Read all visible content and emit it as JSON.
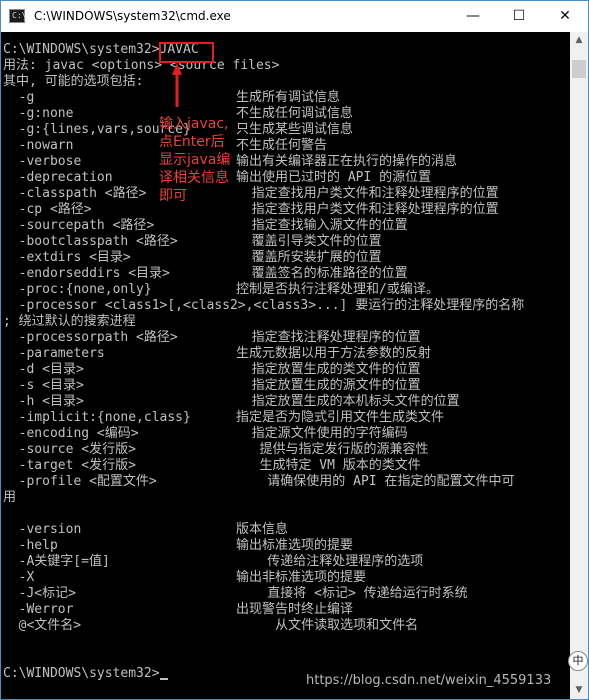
{
  "window": {
    "title": "C:\\WINDOWS\\system32\\cmd.exe",
    "icon_glyph": "C:\\",
    "minimize_glyph": "—",
    "maximize_glyph": "☐",
    "close_glyph": "✕"
  },
  "console": {
    "lines": [
      {
        "a": "C:\\WINDOWS\\system32>JAVAC"
      },
      {
        "a": "用法: javac <options> <source files>"
      },
      {
        "a": "其中, 可能的选项包括:"
      },
      {
        "a": "  -g",
        "b": "生成所有调试信息"
      },
      {
        "a": "  -g:none",
        "b": "不生成任何调试信息"
      },
      {
        "a": "  -g:{lines,vars,source}",
        "b": "只生成某些调试信息"
      },
      {
        "a": "  -nowarn",
        "b": "不生成任何警告"
      },
      {
        "a": "  -verbose",
        "b": "输出有关编译器正在执行的操作的消息"
      },
      {
        "a": "  -deprecation",
        "b": "输出使用已过时的 API 的源位置"
      },
      {
        "a": "  -classpath <路径>",
        "b": "  指定查找用户类文件和注释处理程序的位置"
      },
      {
        "a": "  -cp <路径>",
        "b": "  指定查找用户类文件和注释处理程序的位置"
      },
      {
        "a": "  -sourcepath <路径>",
        "b": "  指定查找输入源文件的位置"
      },
      {
        "a": "  -bootclasspath <路径>",
        "b": "  覆盖引导类文件的位置"
      },
      {
        "a": "  -extdirs <目录>",
        "b": "  覆盖所安装扩展的位置"
      },
      {
        "a": "  -endorseddirs <目录>",
        "b": "  覆盖签名的标准路径的位置"
      },
      {
        "a": "  -proc:{none,only}",
        "b": "控制是否执行注释处理和/或编译。"
      },
      {
        "a": "  -processor <class1>[,<class2>,<class3>...] 要运行的注释处理程序的名称"
      },
      {
        "a": "; 绕过默认的搜索进程"
      },
      {
        "a": "  -processorpath <路径>",
        "b": "  指定查找注释处理程序的位置"
      },
      {
        "a": "  -parameters",
        "b": "生成元数据以用于方法参数的反射"
      },
      {
        "a": "  -d <目录>",
        "b": "  指定放置生成的类文件的位置"
      },
      {
        "a": "  -s <目录>",
        "b": "  指定放置生成的源文件的位置"
      },
      {
        "a": "  -h <目录>",
        "b": "  指定放置生成的本机标头文件的位置"
      },
      {
        "a": "  -implicit:{none,class}",
        "b": "指定是否为隐式引用文件生成类文件"
      },
      {
        "a": "  -encoding <编码>",
        "b": "  指定源文件使用的字符编码"
      },
      {
        "a": "  -source <发行版>",
        "b": "   提供与指定发行版的源兼容性"
      },
      {
        "a": "  -target <发行版>",
        "b": "   生成特定 VM 版本的类文件"
      },
      {
        "a": "  -profile <配置文件>",
        "b": "    请确保使用的 API 在指定的配置文件中可"
      },
      {
        "a": "用"
      },
      {
        "a": ""
      },
      {
        "a": "  -version",
        "b": "版本信息"
      },
      {
        "a": "  -help",
        "b": "输出标准选项的提要"
      },
      {
        "a": "  -A关键字[=值]",
        "b": "    传递给注释处理程序的选项"
      },
      {
        "a": "  -X",
        "b": "输出非标准选项的提要"
      },
      {
        "a": "  -J<标记>",
        "b": "    直接将 <标记> 传递给运行时系统"
      },
      {
        "a": "  -Werror",
        "b": "出现警告时终止编译"
      },
      {
        "a": "  @<文件名>",
        "b": "     从文件读取选项和文件名"
      },
      {
        "a": ""
      },
      {
        "a": ""
      },
      {
        "a": "C:\\WINDOWS\\system32>"
      }
    ]
  },
  "annotation": {
    "text": "输入javac,\n点Enter后\n显示java编\n译相关信息\n即可",
    "color": "#e8423b"
  },
  "scrollbar": {
    "up_glyph": "▲",
    "down_glyph": "▼"
  },
  "watermark": "https://blog.csdn.net/weixin_4559133",
  "ime_glyph": "中",
  "colors": {
    "console_bg": "#000000",
    "console_text": "#c0c0c0",
    "highlight_border": "#e02020"
  }
}
